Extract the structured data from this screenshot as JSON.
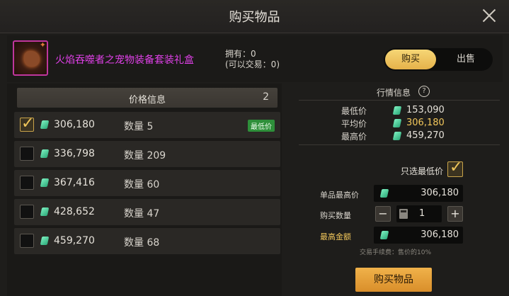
{
  "dialog": {
    "title": "购买物品"
  },
  "item": {
    "name": "火焰吞噬者之宠物装备套装礼盒",
    "owned_line": "拥有：0",
    "tradable_line": "(可以交易：0)"
  },
  "mode": {
    "buy": "购买",
    "sell": "出售",
    "active": "buy"
  },
  "listings": {
    "header": "价格信息",
    "count": "2",
    "rows": [
      {
        "price": "306,180",
        "qty_label": "数量",
        "qty": "5",
        "checked": true,
        "badge": "最低价"
      },
      {
        "price": "336,798",
        "qty_label": "数量",
        "qty": "209",
        "checked": false
      },
      {
        "price": "367,416",
        "qty_label": "数量",
        "qty": "60",
        "checked": false
      },
      {
        "price": "428,652",
        "qty_label": "数量",
        "qty": "47",
        "checked": false
      },
      {
        "price": "459,270",
        "qty_label": "数量",
        "qty": "68",
        "checked": false
      }
    ]
  },
  "market": {
    "title": "行情信息",
    "help": "?",
    "lowest_label": "最低价",
    "lowest": "153,090",
    "avg_label": "平均价",
    "avg": "306,180",
    "highest_label": "最高价",
    "highest": "459,270"
  },
  "purchase": {
    "lowest_only_label": "只选最低价",
    "lowest_only": true,
    "unit_max_label": "单品最高价",
    "unit_max": "306,180",
    "qty_label": "购买数量",
    "qty": "1",
    "minus": "−",
    "plus": "+",
    "total_label": "最高金额",
    "total": "306,180",
    "fee_note": "交易手续费：售价的10%",
    "buy_button": "购买物品"
  },
  "colors": {
    "accent_gold": "#f2c75b",
    "item_name": "#e040e8",
    "badge_green": "#2e8f3a"
  }
}
